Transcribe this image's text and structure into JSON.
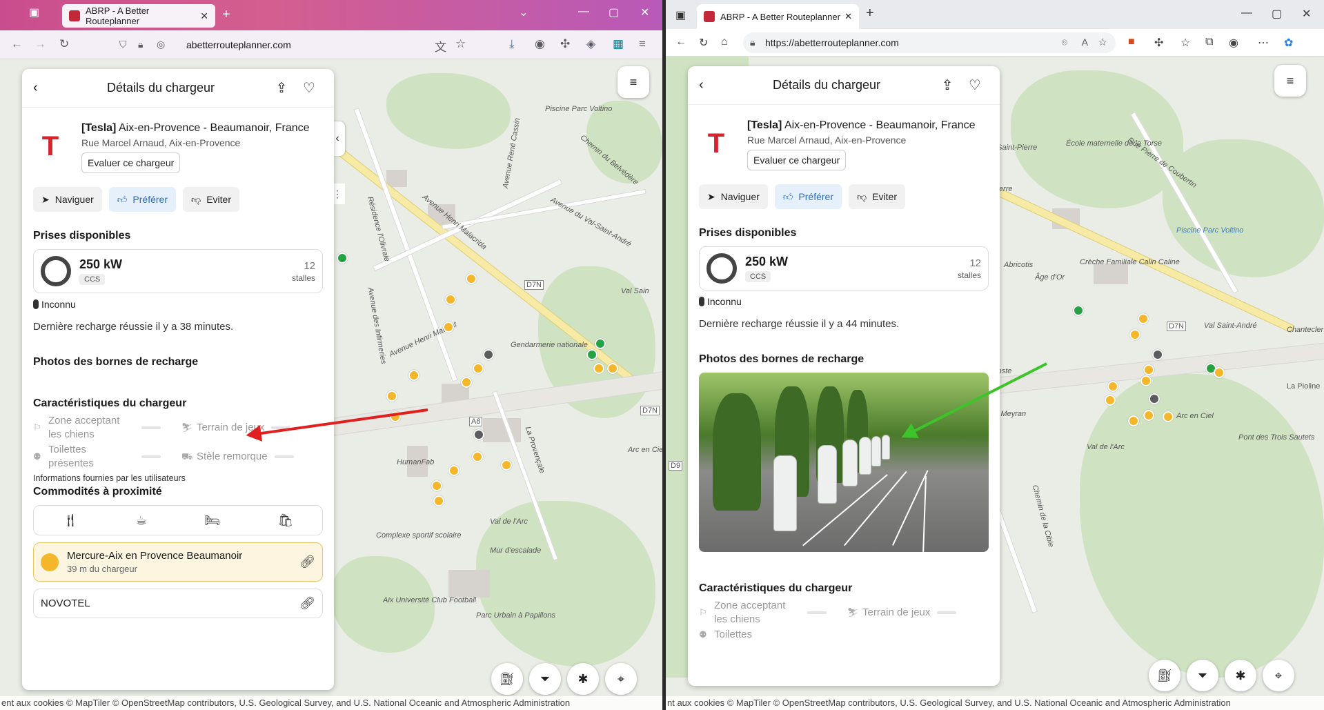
{
  "browser_left": {
    "tab_title": "ABRP - A Better Routeplanner",
    "url": "abetterrouteplanner.com"
  },
  "browser_right": {
    "tab_title": "ABRP - A Better Routeplanner",
    "url": "https://abetterrouteplanner.com"
  },
  "panel_left": {
    "header_title": "Détails du chargeur",
    "station_brand": "[Tesla]",
    "station_name": "Aix-en-Provence - Beaumanoir, France",
    "station_address": "Rue Marcel Arnaud, Aix-en-Provence",
    "rate_button": "Evaluer ce chargeur",
    "actions": {
      "navigate": "Naviguer",
      "prefer": "Préférer",
      "avoid": "Eviter"
    },
    "plugs_title": "Prises disponibles",
    "plug_power": "250 kW",
    "plug_type": "CCS",
    "stall_count": "12",
    "stall_label": "stalles",
    "status": "Inconnu",
    "last_charge": "Dernière recharge réussie il y a 38 minutes.",
    "photos_title": "Photos des bornes de recharge",
    "features_title": "Caractéristiques du chargeur",
    "features": {
      "dogs": "Zone acceptant les chiens",
      "playground": "Terrain de jeux",
      "toilets": "Toilettes présentes",
      "trailer": "Stèle remorque"
    },
    "info_note": "Informations fournies par les utilisateurs",
    "amenities_title": "Commodités à proximité",
    "poi_1_name": "Mercure-Aix en Provence Beaumanoir",
    "poi_1_distance": "39 m du chargeur",
    "poi_2_name": "NOVOTEL"
  },
  "panel_right": {
    "header_title": "Détails du chargeur",
    "station_brand": "[Tesla]",
    "station_name": "Aix-en-Provence - Beaumanoir, France",
    "station_address": "Rue Marcel Arnaud, Aix-en-Provence",
    "rate_button": "Evaluer ce chargeur",
    "actions": {
      "navigate": "Naviguer",
      "prefer": "Préférer",
      "avoid": "Eviter"
    },
    "plugs_title": "Prises disponibles",
    "plug_power": "250 kW",
    "plug_type": "CCS",
    "stall_count": "12",
    "stall_label": "stalles",
    "status": "Inconnu",
    "last_charge": "Dernière recharge réussie il y a 44 minutes.",
    "photos_title": "Photos des bornes de recharge",
    "features_title": "Caractéristiques du chargeur",
    "features": {
      "dogs": "Zone acceptant les chiens",
      "playground": "Terrain de jeux",
      "toilets": "Toilettes"
    }
  },
  "map_left_labels": {
    "l1": "Piscine Parc Voltino",
    "l2": "Chemin du Belvédère",
    "l3": "Avenue René Cassin",
    "l4": "Avenue Henri Malacrida",
    "l5": "Avenue du Val-Saint-André",
    "l6": "Résidence l'Olivraie",
    "l7": "Avenue des Infirmeries",
    "l8": "Avenue Henri Mauriat",
    "l9": "Gendarmerie nationale",
    "l10": "La Provençale",
    "l11": "Val de l'Arc",
    "l12": "HumanFab",
    "l13": "Complexe sportif scolaire",
    "l14": "Aix Université Club Football",
    "l15": "Parc Urbain à Papillons",
    "l16": "Mur d'escalade",
    "l17": "Val Sain",
    "road1": "D7N",
    "road2": "A8",
    "road3": "D7N",
    "l18": "Arc en Ciel"
  },
  "map_right_labels": {
    "l1": "École maternelle de la Torse",
    "l2": "Cimetière Saint-Pierre",
    "l3": "Rue Pierre de Coubertin",
    "l4": "Saint Pierre",
    "l5": "Piscine Parc Voltino",
    "l6": "Crèche Familiale Calin Caline",
    "l7": "Abricotis",
    "l8": "Âge d'Or",
    "l9": "Val Saint-André",
    "l10": "Chantecler",
    "l11": "La Pioline",
    "l12": "Arc en Ciel",
    "l13": "Pont des Trois Sautets",
    "l14": "Val de l'Arc",
    "l15": "Chemin de la Cible",
    "l16": "Avenue de Meyran",
    "l17": "Jean-Paul Coste",
    "road1": "D7N",
    "road2": "D9"
  },
  "attribution": "ent aux cookies  © MapTiler  © OpenStreetMap contributors, U.S. Geological Survey, and U.S. National Oceanic and Atmospheric Administration",
  "attribution_right": "nt aux cookies  © MapTiler  © OpenStreetMap contributors, U.S. Geological Survey, and U.S. National Oceanic and Atmospheric Administration",
  "icons": {
    "back": "chevron-left-icon",
    "share": "share-icon",
    "favorite": "heart-icon",
    "navigate": "navigation-arrow-icon",
    "prefer": "thumbs-up-icon",
    "avoid": "thumbs-down-icon",
    "restaurant": "fork-knife-icon",
    "cafe": "coffee-icon",
    "hotel": "bed-icon",
    "shopping": "shopping-bag-icon",
    "link": "link-icon",
    "menu": "hamburger-menu-icon",
    "route": "route-plan-icon",
    "filter": "filter-icon",
    "bug": "bug-icon",
    "locate": "crosshair-locate-icon"
  },
  "colors": {
    "tesla_red": "#d6232e",
    "prefer_blue": "#2a6cc4",
    "charger_pin": "#f4b62a",
    "highlight_bg": "#fdf5df",
    "arrow_red": "#e02020",
    "arrow_green": "#3ec42b"
  }
}
